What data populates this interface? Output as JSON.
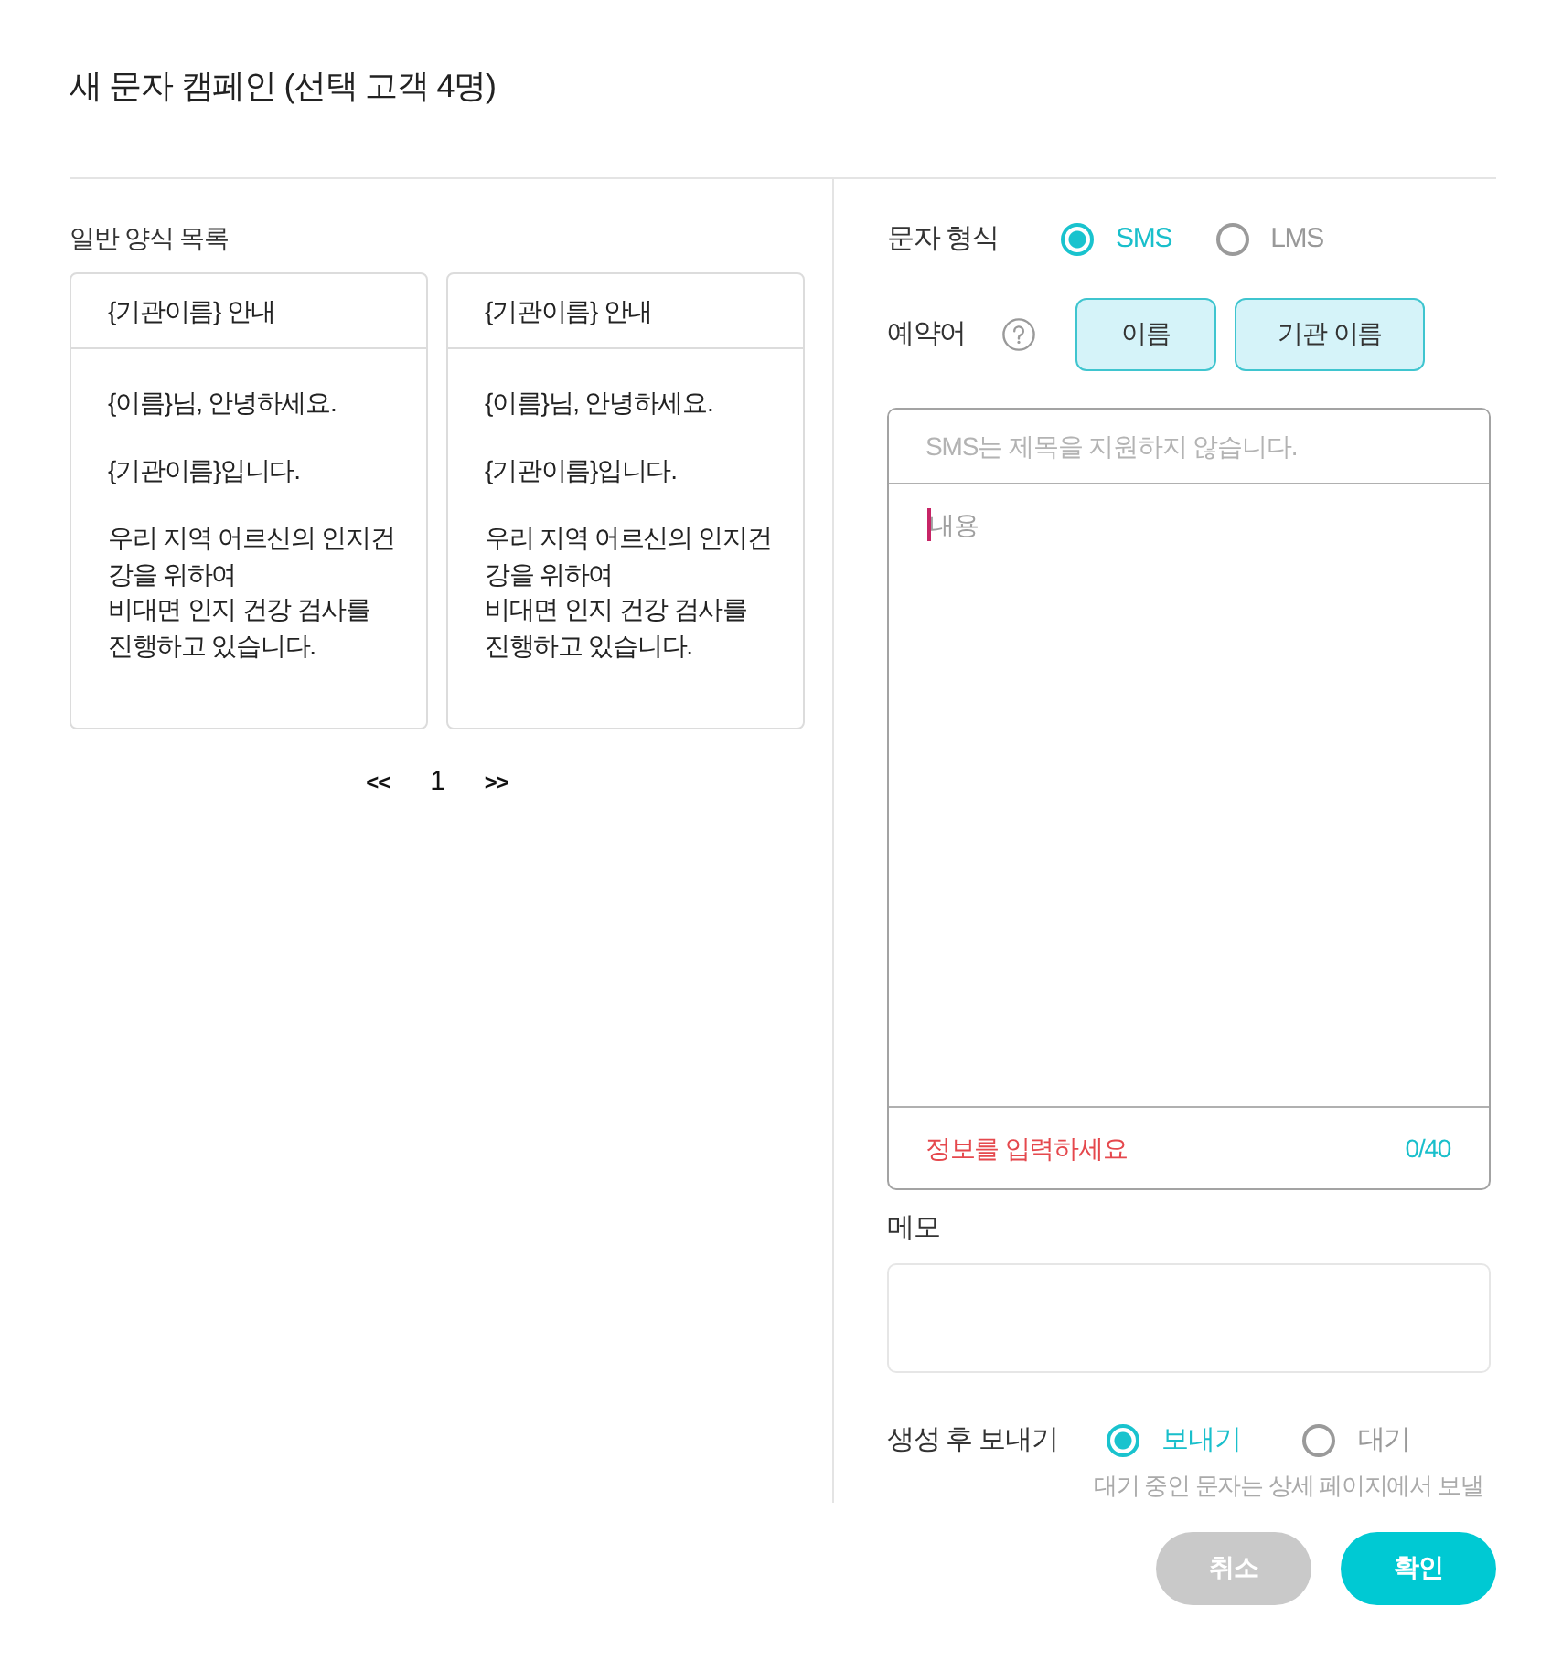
{
  "dialog": {
    "title": "새 문자 캠페인 (선택 고객 4명)"
  },
  "templates": {
    "heading": "일반 양식 목록",
    "cards": [
      {
        "title": "{기관이름} 안내",
        "paragraphs": [
          "{이름}님, 안녕하세요.",
          "{기관이름}입니다.",
          "우리 지역 어르신의 인지건강을 위하여\n비대면 인지 건강 검사를 진행하고 있습니다."
        ]
      },
      {
        "title": "{기관이름} 안내",
        "paragraphs": [
          "{이름}님, 안녕하세요.",
          "{기관이름}입니다.",
          "우리 지역 어르신의 인지건강을 위하여\n비대면 인지 건강 검사를 진행하고 있습니다."
        ]
      }
    ],
    "pagination": {
      "prev": "<<",
      "pages": [
        "1"
      ],
      "next": ">>"
    }
  },
  "form": {
    "message_type": {
      "label": "문자 형식",
      "options": [
        {
          "label": "SMS",
          "selected": true
        },
        {
          "label": "LMS",
          "selected": false
        }
      ]
    },
    "reserved_words": {
      "label": "예약어",
      "buttons": [
        "이름",
        "기관 이름"
      ]
    },
    "message": {
      "title": {
        "placeholder": "SMS는 제목을 지원하지 않습니다."
      },
      "content": {
        "placeholder": "내용",
        "focused": true
      },
      "error": "정보를 입력하세요",
      "counter": "0/40"
    },
    "memo": {
      "label": "메모"
    },
    "send_after_create": {
      "label": "생성 후 보내기",
      "options": [
        {
          "label": "보내기",
          "selected": true
        },
        {
          "label": "대기",
          "selected": false
        }
      ],
      "hint": "대기 중인 문자는 상세 페이지에서 보낼"
    }
  },
  "buttons": [
    {
      "label": "취소",
      "kind": "cancel"
    },
    {
      "label": "확인",
      "kind": "confirm"
    }
  ]
}
